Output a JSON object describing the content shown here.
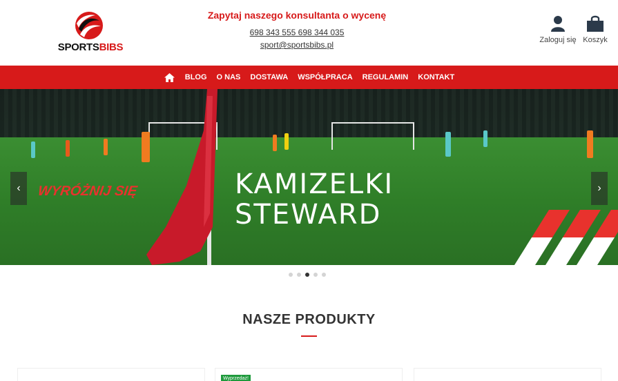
{
  "brand": {
    "part1": "SPORTS",
    "part2": "BIBS"
  },
  "contact": {
    "ask": "Zapytaj naszego konsultanta o wycenę",
    "phones": " 698 343 555 698 344 035",
    "email": " sport@sportsbibs.pl"
  },
  "header_actions": {
    "login": "Zaloguj się",
    "cart": "Koszyk"
  },
  "nav": {
    "items": [
      "BLOG",
      "O NAS",
      "DOSTAWA",
      "WSPÓŁPRACA",
      "REGULAMIN",
      "KONTAKT"
    ]
  },
  "hero": {
    "title_line1": "KAMIZELKI",
    "title_line2": "STEWARD",
    "subtitle": "WYRÓŻNIJ SIĘ",
    "prev_arrow": "‹",
    "next_arrow": "›",
    "slide_count": 5,
    "active_slide": 3
  },
  "products_section": {
    "title": "NASZE PRODUKTY",
    "badge": "Wyprzedaż!"
  },
  "colors": {
    "accent": "#d71a1a",
    "badge_green": "#1e9a3c"
  },
  "icons": {
    "home": "home-icon",
    "login": "user-icon",
    "cart": "shopping-bag-icon"
  }
}
